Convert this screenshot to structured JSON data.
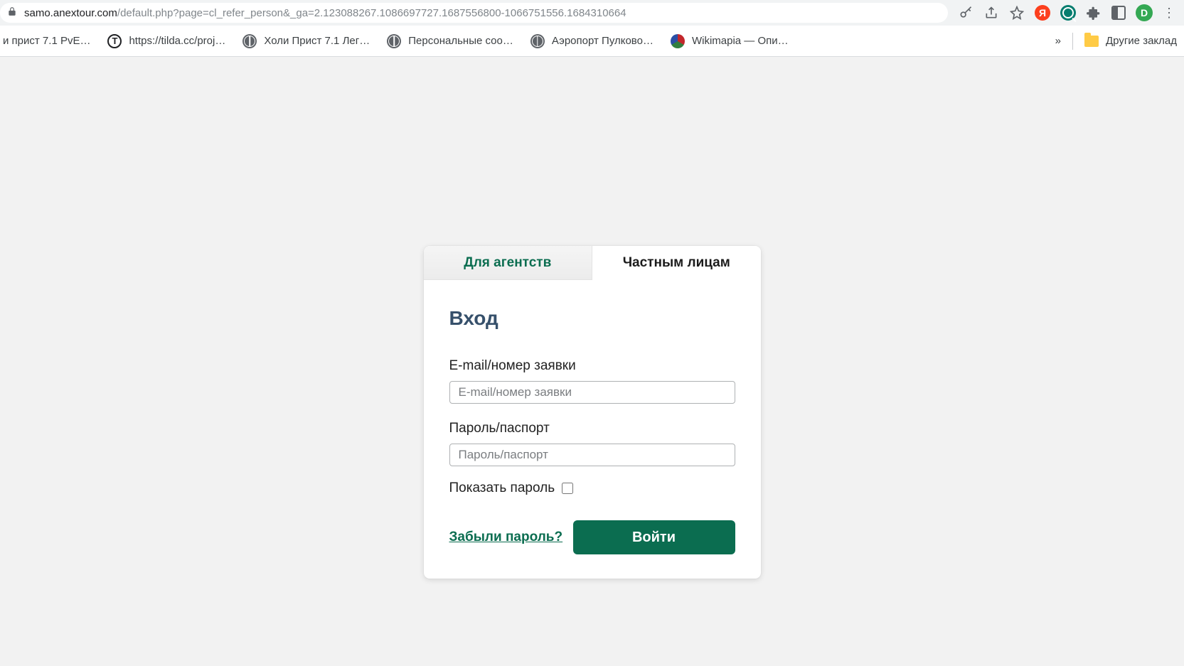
{
  "browser": {
    "url_host": "samo.anextour.com",
    "url_path": "/default.php?page=cl_refer_person&_ga=2.123088267.1086697727.1687556800-1066751556.1684310664",
    "avatar_initial": "D",
    "yandex_letter": "Я"
  },
  "bookmarks": {
    "items": [
      {
        "label": "и прист 7.1 PvE…"
      },
      {
        "label": "https://tilda.cc/proj…"
      },
      {
        "label": "Холи Прист 7.1 Лег…"
      },
      {
        "label": "Персональные соо…"
      },
      {
        "label": "Аэропорт Пулково…"
      },
      {
        "label": "Wikimapia — Опи…"
      }
    ],
    "overflow": "»",
    "other_label": "Другие заклад"
  },
  "login": {
    "tab_agencies": "Для агентств",
    "tab_private": "Частным лицам",
    "title": "Вход",
    "email_label": "E-mail/номер заявки",
    "email_placeholder": "E-mail/номер заявки",
    "password_label": "Пароль/паспорт",
    "password_placeholder": "Пароль/паспорт",
    "show_password_label": "Показать пароль",
    "forgot_link": "Забыли пароль?",
    "submit_label": "Войти"
  }
}
